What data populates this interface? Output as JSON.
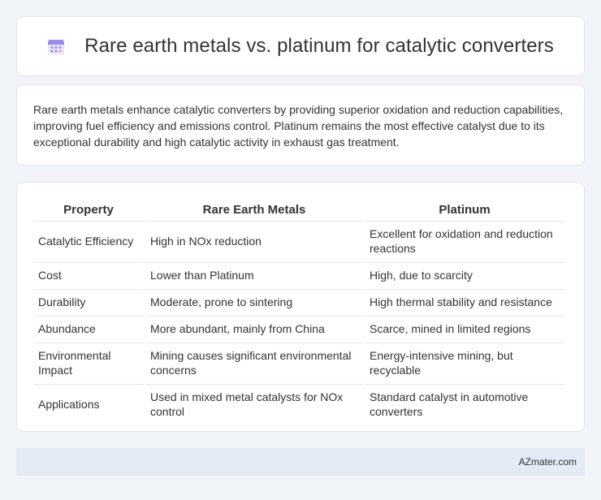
{
  "header": {
    "title": "Rare earth metals vs. platinum for catalytic converters",
    "icon": "calendar-icon"
  },
  "summary": {
    "text": "Rare earth metals enhance catalytic converters by providing superior oxidation and reduction capabilities, improving fuel efficiency and emissions control. Platinum remains the most effective catalyst due to its exceptional durability and high catalytic activity in exhaust gas treatment."
  },
  "table": {
    "headers": [
      "Property",
      "Rare Earth Metals",
      "Platinum"
    ],
    "rows": [
      [
        "Catalytic Efficiency",
        "High in NOx reduction",
        "Excellent for oxidation and reduction reactions"
      ],
      [
        "Cost",
        "Lower than Platinum",
        "High, due to scarcity"
      ],
      [
        "Durability",
        "Moderate, prone to sintering",
        "High thermal stability and resistance"
      ],
      [
        "Abundance",
        "More abundant, mainly from China",
        "Scarce, mined in limited regions"
      ],
      [
        "Environmental Impact",
        "Mining causes significant environmental concerns",
        "Energy-intensive mining, but recyclable"
      ],
      [
        "Applications",
        "Used in mixed metal catalysts for NOx control",
        "Standard catalyst in automotive converters"
      ]
    ]
  },
  "footer": {
    "brand": "AZmater.com"
  },
  "colors": {
    "page_background": "#f1f4f9",
    "card_background": "#ffffff",
    "footer_background": "#e4ebf6",
    "icon_accent": "#8f7fe0"
  }
}
